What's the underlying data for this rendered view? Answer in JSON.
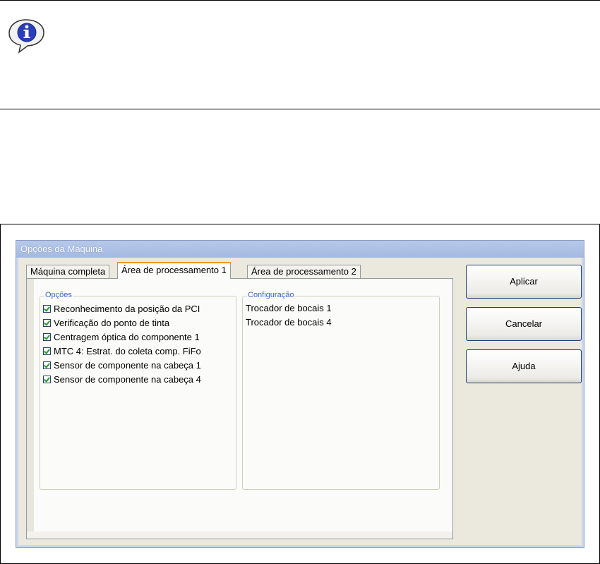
{
  "dialog": {
    "title": "Opções da Máquina",
    "tabs": [
      {
        "label": "Máquina completa"
      },
      {
        "label": "Área de processamento 1"
      },
      {
        "label": "Área de processamento 2"
      }
    ],
    "active_tab": 1,
    "options_group": {
      "legend": "Opções",
      "items": [
        {
          "label": "Reconhecimento da posição da PCI",
          "checked": true
        },
        {
          "label": "Verificação do ponto de tinta",
          "checked": true
        },
        {
          "label": "Centragem óptica do componente 1",
          "checked": true
        },
        {
          "label": "MTC 4: Estrat. do coleta comp. FiFo",
          "checked": true
        },
        {
          "label": "Sensor de componente na cabeça 1",
          "checked": true
        },
        {
          "label": "Sensor de componente na cabeça 4",
          "checked": true
        }
      ]
    },
    "config_group": {
      "legend": "Configuração",
      "items": [
        "Trocador de bocais 1",
        "Trocador de bocais 4"
      ]
    },
    "buttons": {
      "apply": "Aplicar",
      "cancel": "Cancelar",
      "help": "Ajuda"
    }
  },
  "colors": {
    "legend_text": "#3a63d8",
    "active_tab_accent": "#e79b2b",
    "check_mark": "#1f9b28"
  },
  "icons": {
    "note": "info-icon"
  }
}
